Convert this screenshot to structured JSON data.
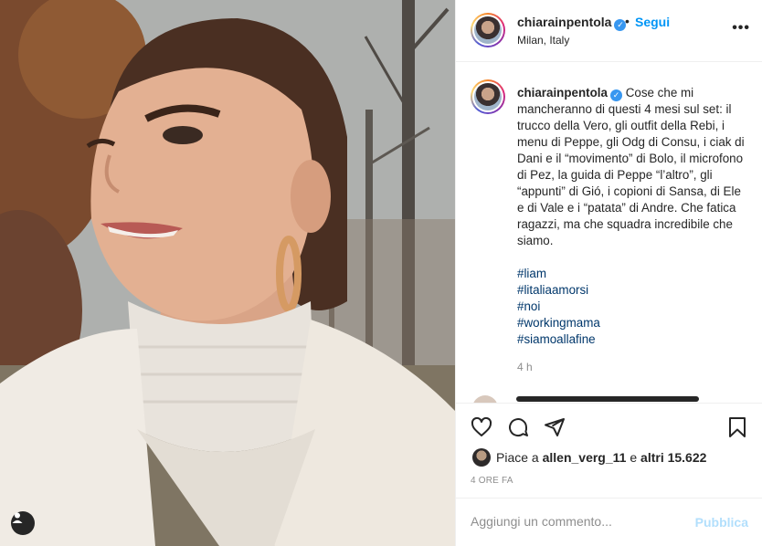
{
  "post": {
    "photo_alt": "smiling woman in turtleneck and white coat",
    "user_tag_icon": "person-icon"
  },
  "header": {
    "username": "chiarainpentola",
    "verified_icon": "verified-badge-icon",
    "separator": "•",
    "follow_label": "Segui",
    "location": "Milan, Italy",
    "more_label": "•••"
  },
  "caption": {
    "username": "chiarainpentola",
    "text": "Cose che mi mancheranno di questi 4 mesi sul set: il trucco della Vero, gli outfit della Rebi, i menu di Peppe, gli Odg di Consu, i ciak di Dani e il “movimento” di Bolo, il microfono di Pez, la guida di Peppe “l’altro”, gli “appunti” di Gió, i copioni di Sansa, di Ele e di Vale e i “patata” di Andre. Che fatica ragazzi, ma che squadra incredibile che siamo.",
    "hashtags": [
      "#liam",
      "#litaliaamorsi",
      "#noi",
      "#workingmama",
      "#siamoallafine"
    ],
    "time_ago": "4 h"
  },
  "actions": {
    "like_icon": "heart-icon",
    "comment_icon": "comment-icon",
    "share_icon": "share-icon",
    "save_icon": "bookmark-icon"
  },
  "likes": {
    "prefix": "Piace a ",
    "user": "allen_verg_11",
    "middle": " e ",
    "others": "altri 15.622"
  },
  "date": "4 ORE FA",
  "comment_box": {
    "placeholder": "Aggiungi un commento...",
    "publish_label": "Pubblica"
  },
  "colors": {
    "link_blue": "#0095f6",
    "hashtag": "#00376b",
    "muted": "#8e8e8e",
    "publish_disabled": "#b2dffc"
  }
}
